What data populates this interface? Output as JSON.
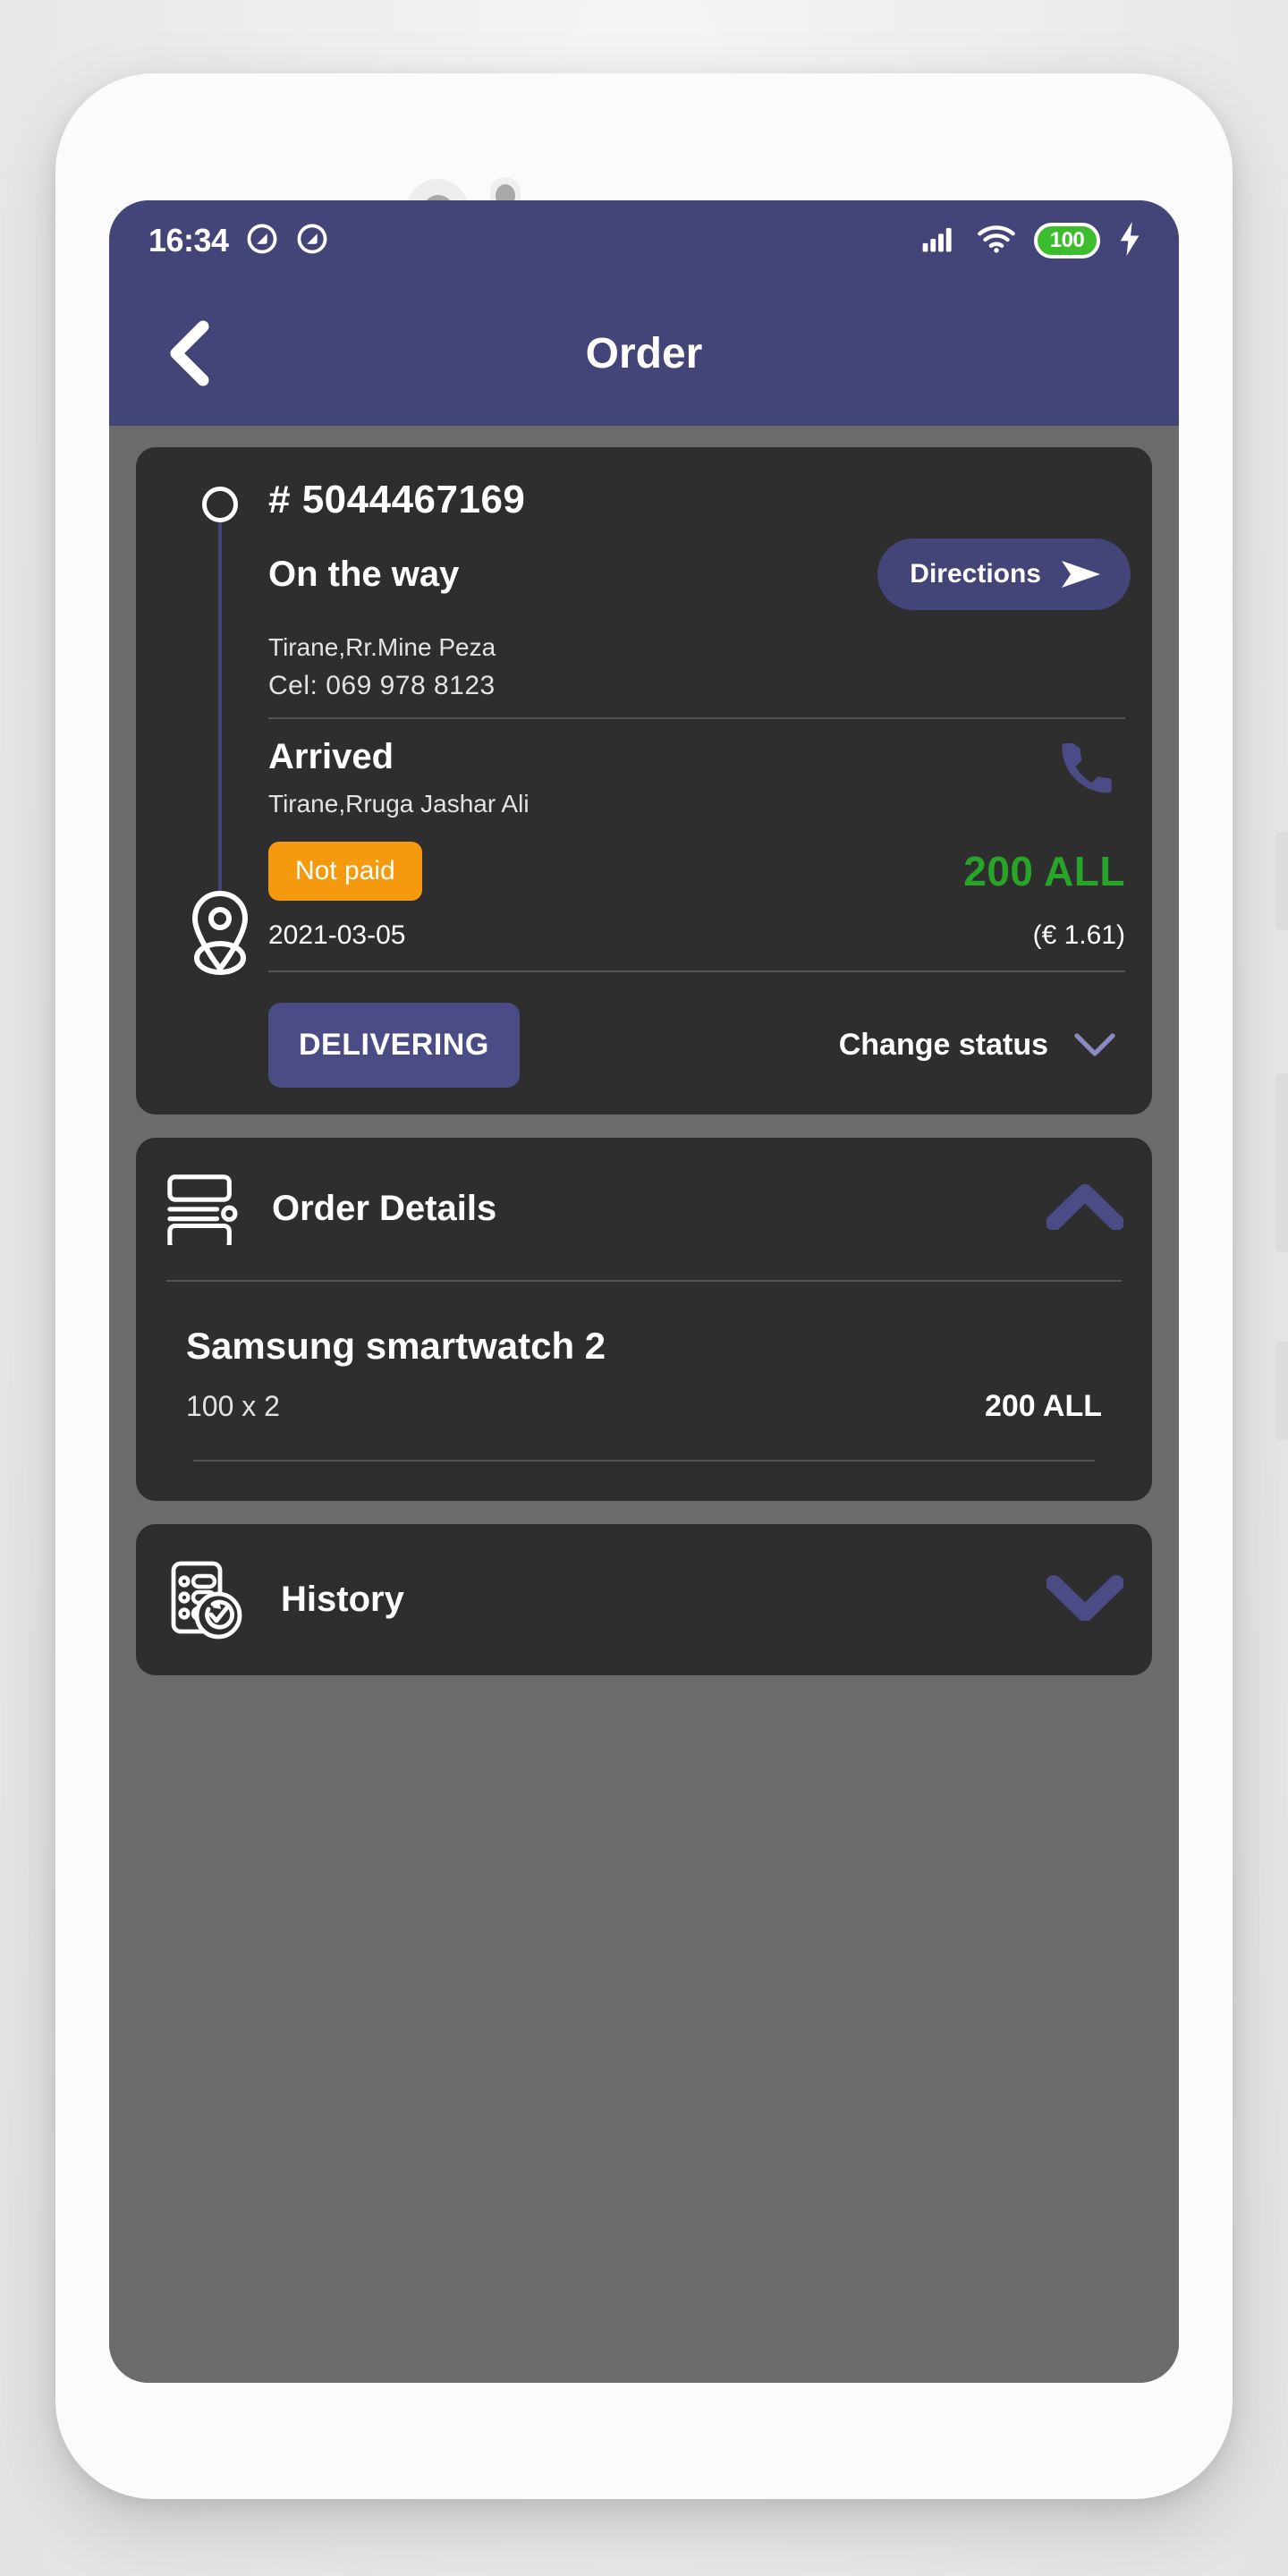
{
  "statusbar": {
    "time": "16:34",
    "icons": [
      "do-not-disturb-icon",
      "do-not-disturb-icon",
      "signal-icon",
      "wifi-icon",
      "battery-icon",
      "charging-bolt-icon"
    ],
    "battery_level": "100"
  },
  "appbar": {
    "title": "Order",
    "back_icon": "back-chevron-icon"
  },
  "order": {
    "number": "# 5044467169",
    "status_current": "On the way",
    "directions_label": "Directions",
    "pickup_address": "Tirane,Rr.Mine Peza",
    "phone_label": "Cel:",
    "phone_number": "069 978 8123",
    "destination_status": "Arrived",
    "destination_address": "Tirane,Rruga Jashar Ali",
    "payment_badge": "Not paid",
    "price": "200 ALL",
    "date": "2021-03-05",
    "price_eur": "(€ 1.61)",
    "delivering_label": "DELIVERING",
    "change_status_label": "Change status"
  },
  "order_details": {
    "title": "Order Details",
    "expanded": true,
    "items": [
      {
        "name": "Samsung smartwatch 2",
        "qty": "100 x 2",
        "price": "200 ALL"
      }
    ]
  },
  "history": {
    "title": "History",
    "expanded": false
  },
  "navbar": {
    "recent_label": "recent-apps-icon",
    "home_label": "home-icon",
    "back_label": "back-icon"
  },
  "colors": {
    "brand": "#434478",
    "card": "#2e2e2e",
    "screen_bg": "#6b6b6b",
    "accent_orange": "#f59a0e",
    "accent_green": "#28a428",
    "battery_green": "#3bbd2e"
  }
}
